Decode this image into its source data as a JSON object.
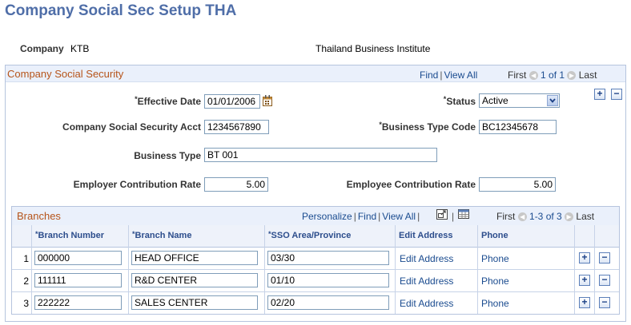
{
  "page": {
    "title": "Company Social Sec Setup THA"
  },
  "company": {
    "label": "Company",
    "code": "KTB",
    "name": "Thailand Business Institute"
  },
  "social_security": {
    "title": "Company Social Security",
    "nav": {
      "find": "Find",
      "view_all": "View All",
      "first": "First",
      "range": "1 of 1",
      "last": "Last"
    },
    "effective_date": {
      "label": "Effective Date",
      "value": "01/01/2006"
    },
    "status": {
      "label": "Status",
      "value": "Active"
    },
    "acct": {
      "label": "Company Social Security Acct",
      "value": "1234567890"
    },
    "business_type_code": {
      "label": "Business Type Code",
      "value": "BC12345678"
    },
    "business_type": {
      "label": "Business Type",
      "value": "BT 001"
    },
    "employer_rate": {
      "label": "Employer Contribution Rate",
      "value": "5.00"
    },
    "employee_rate": {
      "label": "Employee Contribution Rate",
      "value": "5.00"
    }
  },
  "branches": {
    "title": "Branches",
    "nav": {
      "personalize": "Personalize",
      "find": "Find",
      "view_all": "View All",
      "first": "First",
      "range": "1-3 of 3",
      "last": "Last"
    },
    "columns": {
      "branch_number": "Branch Number",
      "branch_name": "Branch Name",
      "sso_area": "SSO Area/Province",
      "edit_address": "Edit Address",
      "phone": "Phone"
    },
    "rows": [
      {
        "num": "1",
        "branch_number": "000000",
        "branch_name": "HEAD OFFICE",
        "sso_area": "03/30",
        "edit_address": "Edit Address",
        "phone": "Phone"
      },
      {
        "num": "2",
        "branch_number": "111111",
        "branch_name": "R&D CENTER",
        "sso_area": "01/10",
        "edit_address": "Edit Address",
        "phone": "Phone"
      },
      {
        "num": "3",
        "branch_number": "222222",
        "branch_name": "SALES CENTER",
        "sso_area": "02/20",
        "edit_address": "Edit Address",
        "phone": "Phone"
      }
    ]
  },
  "symbols": {
    "required": "*",
    "plus": "+",
    "minus": "−",
    "prev": "◀",
    "next": "▶"
  }
}
